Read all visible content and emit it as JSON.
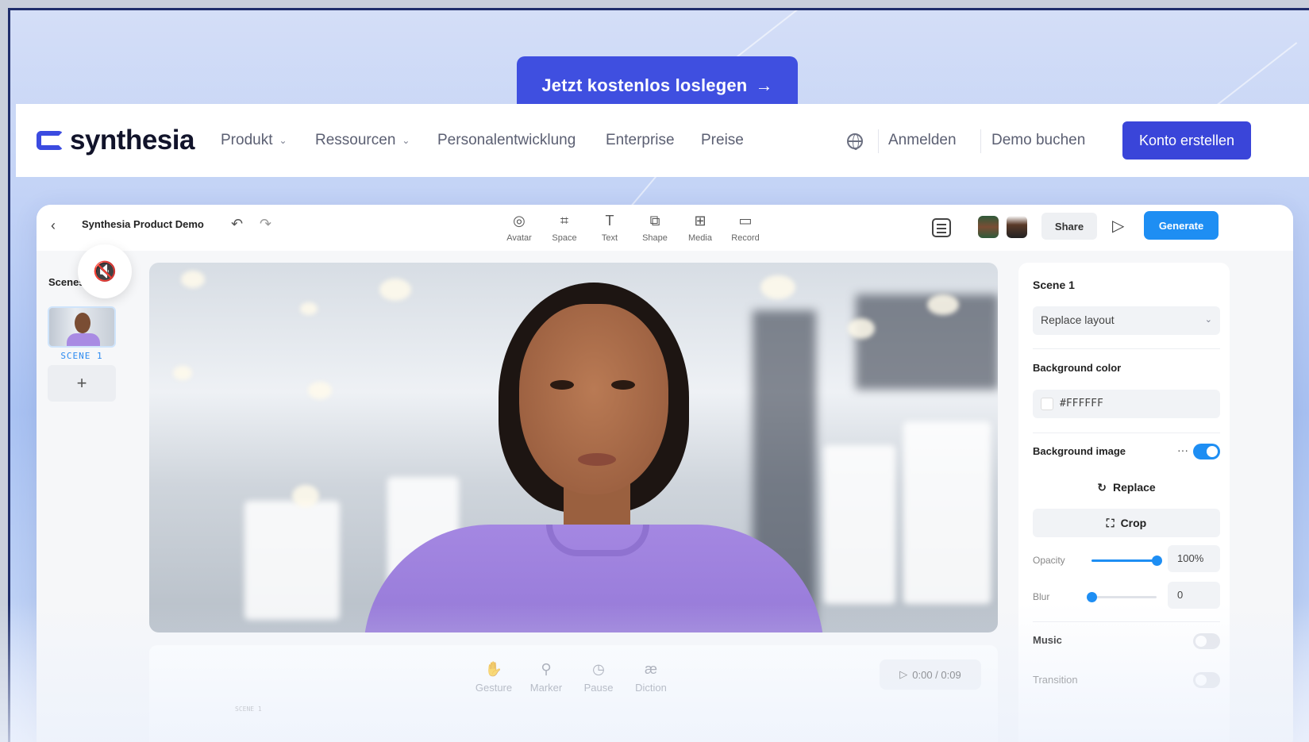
{
  "promo": {
    "cta_label": "Jetzt kostenlos loslegen",
    "cta_arrow": "→"
  },
  "nav": {
    "logo_text": "synthesia",
    "items": [
      {
        "label": "Produkt",
        "has_dropdown": true
      },
      {
        "label": "Ressourcen",
        "has_dropdown": true
      },
      {
        "label": "Personalentwicklung",
        "has_dropdown": false
      },
      {
        "label": "Enterprise",
        "has_dropdown": false
      },
      {
        "label": "Preise",
        "has_dropdown": false
      }
    ],
    "language_icon": "globe-icon",
    "login_label": "Anmelden",
    "demo_label": "Demo buchen",
    "signup_label": "Konto erstellen",
    "accent_color": "#3a45d9"
  },
  "editor": {
    "project_title": "Synthesia Product Demo",
    "tools": [
      {
        "label": "Avatar",
        "icon": "avatar-icon"
      },
      {
        "label": "Space",
        "icon": "space-icon"
      },
      {
        "label": "Text",
        "icon": "text-icon"
      },
      {
        "label": "Shape",
        "icon": "shape-icon"
      },
      {
        "label": "Media",
        "icon": "media-icon"
      },
      {
        "label": "Record",
        "icon": "record-icon"
      }
    ],
    "share_label": "Share",
    "generate_label": "Generate",
    "generate_color": "#1e8ef3"
  },
  "scenes": {
    "label": "Scenes",
    "items": [
      {
        "name": "SCENE 1"
      }
    ],
    "add_label": "+"
  },
  "timeline": {
    "tools": [
      {
        "label": "Gesture",
        "icon": "gesture-icon"
      },
      {
        "label": "Marker",
        "icon": "marker-icon"
      },
      {
        "label": "Pause",
        "icon": "pause-clock-icon"
      },
      {
        "label": "Diction",
        "icon": "diction-icon"
      }
    ],
    "timer": "0:00 / 0:09",
    "scene_mini": "SCENE 1"
  },
  "properties": {
    "scene_title": "Scene 1",
    "layout_select": "Replace layout",
    "bg_color_label": "Background color",
    "bg_color_value": "#FFFFFF",
    "bg_image_label": "Background image",
    "bg_image_enabled": true,
    "more_label": "···",
    "replace_label": "Replace",
    "crop_label": "Crop",
    "opacity_label": "Opacity",
    "opacity_value": "100%",
    "opacity_fraction": 1.0,
    "blur_label": "Blur",
    "blur_value": "0",
    "blur_fraction": 0.0,
    "music_label": "Music",
    "music_enabled": false,
    "transition_label": "Transition",
    "transition_enabled": false
  }
}
